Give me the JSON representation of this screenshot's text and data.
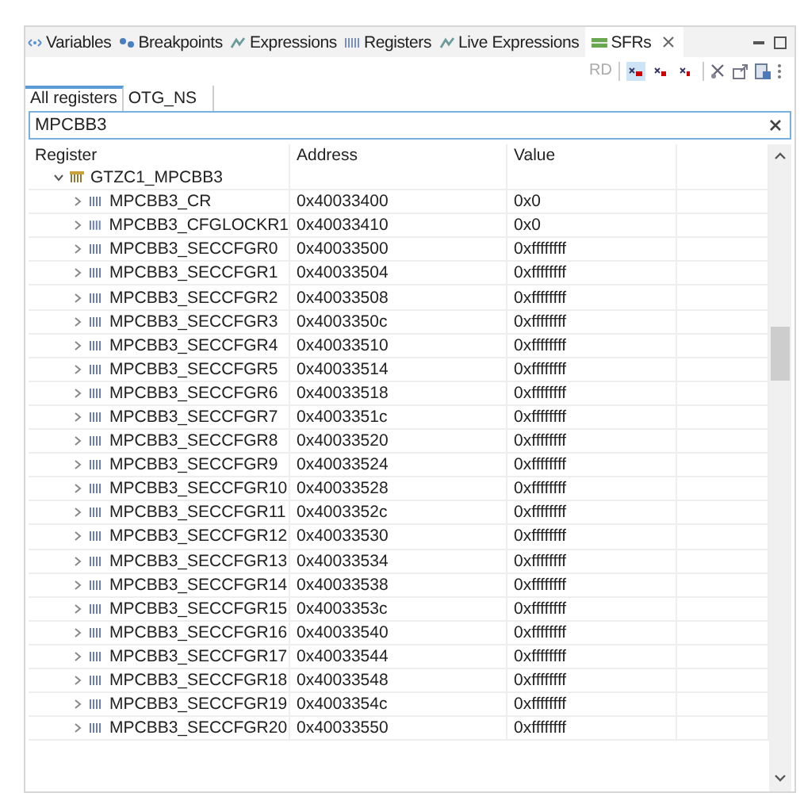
{
  "view_tabs": [
    {
      "label": "Variables",
      "selected": false
    },
    {
      "label": "Breakpoints",
      "selected": false
    },
    {
      "label": "Expressions",
      "selected": false
    },
    {
      "label": "Registers",
      "selected": false
    },
    {
      "label": "Live Expressions",
      "selected": false
    },
    {
      "label": "SFRs",
      "selected": true,
      "closable": true
    }
  ],
  "toolbar": {
    "read_label": "RD",
    "format_buttons": [
      {
        "selected": true
      },
      {
        "selected": false
      },
      {
        "selected": false
      }
    ]
  },
  "register_tabs": [
    {
      "label": "All registers",
      "selected": true
    },
    {
      "label": "OTG_NS",
      "selected": false
    }
  ],
  "filter": {
    "value": "MPCBB3"
  },
  "table": {
    "columns": [
      "Register",
      "Address",
      "Value"
    ],
    "rows": [
      {
        "name": "GTZC1_MPCBB3",
        "expanded": true,
        "children": [
          {
            "name": "MPCBB3_CR",
            "address": "0x40033400",
            "value": "0x0",
            "expanded": false
          },
          {
            "name": "MPCBB3_CFGLOCKR1",
            "address": "0x40033410",
            "value": "0x0",
            "expanded": false
          },
          {
            "name": "MPCBB3_SECCFGR0",
            "address": "0x40033500",
            "value": "0xffffffff",
            "expanded": false
          },
          {
            "name": "MPCBB3_SECCFGR1",
            "address": "0x40033504",
            "value": "0xffffffff",
            "expanded": false
          },
          {
            "name": "MPCBB3_SECCFGR2",
            "address": "0x40033508",
            "value": "0xffffffff",
            "expanded": false
          },
          {
            "name": "MPCBB3_SECCFGR3",
            "address": "0x4003350c",
            "value": "0xffffffff",
            "expanded": false
          },
          {
            "name": "MPCBB3_SECCFGR4",
            "address": "0x40033510",
            "value": "0xffffffff",
            "expanded": false
          },
          {
            "name": "MPCBB3_SECCFGR5",
            "address": "0x40033514",
            "value": "0xffffffff",
            "expanded": false
          },
          {
            "name": "MPCBB3_SECCFGR6",
            "address": "0x40033518",
            "value": "0xffffffff",
            "expanded": false
          },
          {
            "name": "MPCBB3_SECCFGR7",
            "address": "0x4003351c",
            "value": "0xffffffff",
            "expanded": false
          },
          {
            "name": "MPCBB3_SECCFGR8",
            "address": "0x40033520",
            "value": "0xffffffff",
            "expanded": false
          },
          {
            "name": "MPCBB3_SECCFGR9",
            "address": "0x40033524",
            "value": "0xffffffff",
            "expanded": false
          },
          {
            "name": "MPCBB3_SECCFGR10",
            "address": "0x40033528",
            "value": "0xffffffff",
            "expanded": false
          },
          {
            "name": "MPCBB3_SECCFGR11",
            "address": "0x4003352c",
            "value": "0xffffffff",
            "expanded": false
          },
          {
            "name": "MPCBB3_SECCFGR12",
            "address": "0x40033530",
            "value": "0xffffffff",
            "expanded": false
          },
          {
            "name": "MPCBB3_SECCFGR13",
            "address": "0x40033534",
            "value": "0xffffffff",
            "expanded": false
          },
          {
            "name": "MPCBB3_SECCFGR14",
            "address": "0x40033538",
            "value": "0xffffffff",
            "expanded": false
          },
          {
            "name": "MPCBB3_SECCFGR15",
            "address": "0x4003353c",
            "value": "0xffffffff",
            "expanded": false
          },
          {
            "name": "MPCBB3_SECCFGR16",
            "address": "0x40033540",
            "value": "0xffffffff",
            "expanded": false
          },
          {
            "name": "MPCBB3_SECCFGR17",
            "address": "0x40033544",
            "value": "0xffffffff",
            "expanded": false
          },
          {
            "name": "MPCBB3_SECCFGR18",
            "address": "0x40033548",
            "value": "0xffffffff",
            "expanded": false
          },
          {
            "name": "MPCBB3_SECCFGR19",
            "address": "0x4003354c",
            "value": "0xffffffff",
            "expanded": false
          },
          {
            "name": "MPCBB3_SECCFGR20",
            "address": "0x40033550",
            "value": "0xffffffff",
            "expanded": false
          }
        ]
      }
    ]
  }
}
